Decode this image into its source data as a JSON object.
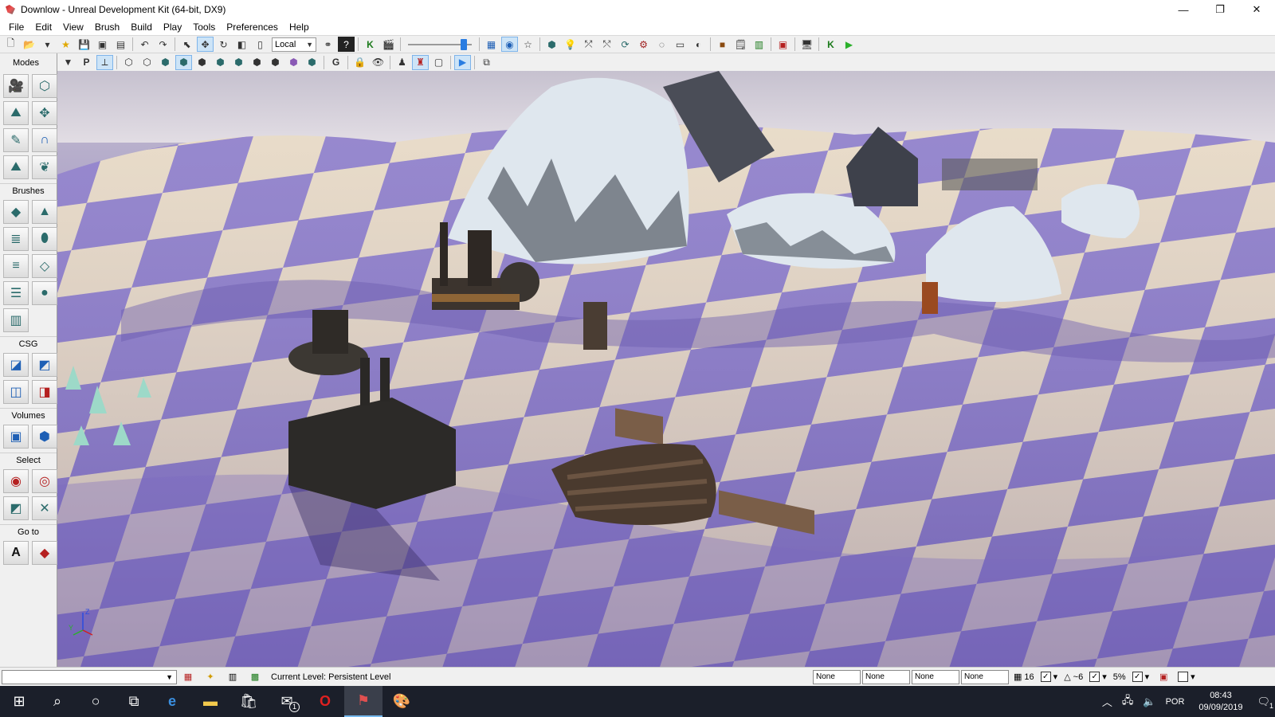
{
  "window": {
    "title": "Downlow - Unreal Development Kit (64-bit, DX9)",
    "minimize": "—",
    "maximize": "❐",
    "close": "✕"
  },
  "menu": [
    "File",
    "Edit",
    "View",
    "Brush",
    "Build",
    "Play",
    "Tools",
    "Preferences",
    "Help"
  ],
  "toolbar": {
    "coord_system": "Local",
    "slider_value_fraction": 0.92
  },
  "modes_panel": {
    "header": "Modes",
    "sections": {
      "brushes": "Brushes",
      "csg": "CSG",
      "volumes": "Volumes",
      "select": "Select",
      "goto": "Go to"
    },
    "goto_actor_glyph": "A"
  },
  "status": {
    "current_level": "Current Level:  Persistent Level",
    "none_fields": [
      "None",
      "None",
      "None",
      "None"
    ],
    "grid_size": "16",
    "rotation_snap": "~6",
    "scale_snap": "5%"
  },
  "taskbar": {
    "language": "POR",
    "time": "08:43",
    "date": "09/09/2019",
    "mail_badge": "1",
    "notification_count": "1"
  },
  "viewport": {
    "axis_labels": {
      "z": "Z",
      "y": "Y"
    }
  },
  "colors": {
    "accent": "#2a7de1",
    "taskbar": "#1b1f2a",
    "terrain_purple": "#7c6cb8",
    "terrain_sand": "#e8d9c2",
    "snow": "#dfe7ee"
  }
}
